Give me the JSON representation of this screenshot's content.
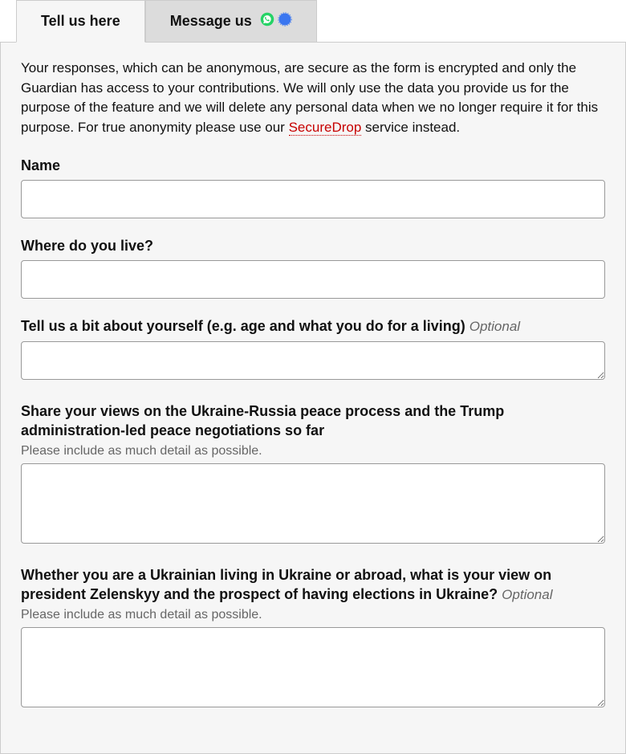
{
  "tabs": {
    "tell_us": "Tell us here",
    "message_us": "Message us"
  },
  "intro": {
    "text_before": "Your responses, which can be anonymous, are secure as the form is encrypted and only the Guardian has access to your contributions. We will only use the data you provide us for the purpose of the feature and we will delete any personal data when we no longer require it for this purpose. For true anonymity please use our ",
    "link_text": "SecureDrop",
    "text_after": " service instead."
  },
  "optional_tag": "Optional",
  "fields": {
    "name": {
      "label": "Name"
    },
    "location": {
      "label": "Where do you live?"
    },
    "about": {
      "label": "Tell us a bit about yourself (e.g. age and what you do for a living)"
    },
    "views": {
      "label": "Share your views on the Ukraine-Russia peace process and the Trump administration-led peace negotiations so far",
      "hint": "Please include as much detail as possible."
    },
    "zelenskyy": {
      "label": "Whether you are a Ukrainian living in Ukraine or abroad, what is your view on president Zelenskyy and the prospect of having elections in Ukraine?",
      "hint": "Please include as much detail as possible."
    }
  }
}
